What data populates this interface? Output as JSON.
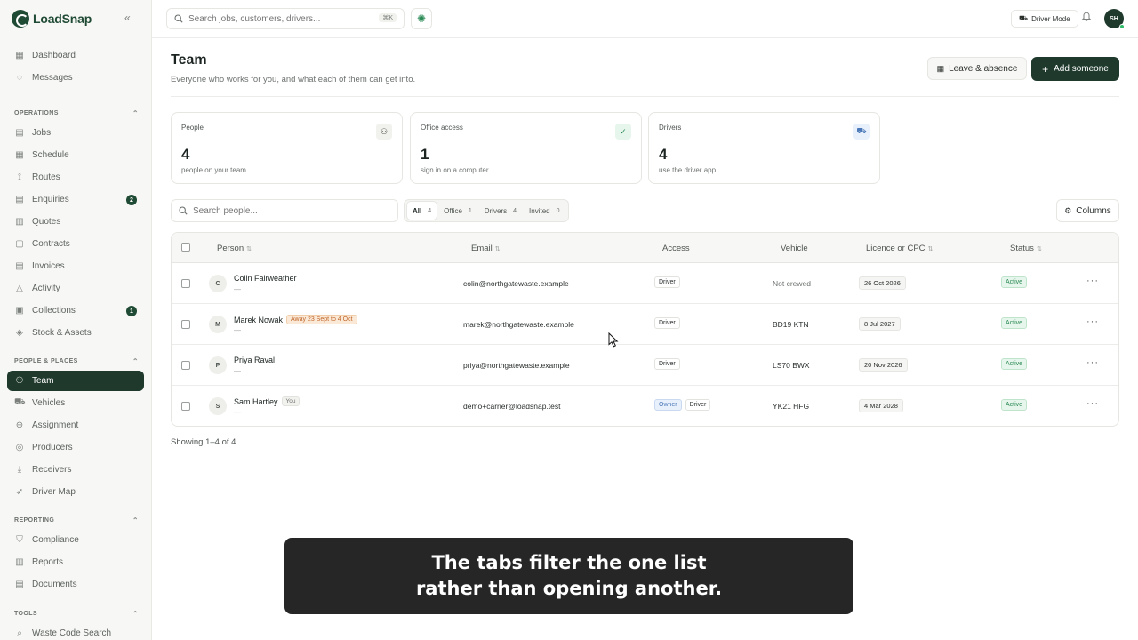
{
  "brand": {
    "name": "LoadSnap"
  },
  "sidebar": {
    "top_items": [
      {
        "label": "Dashboard",
        "icon": "grid-icon"
      },
      {
        "label": "Messages",
        "icon": "chat-icon"
      }
    ],
    "sections": [
      {
        "label": "OPERATIONS",
        "items": [
          {
            "label": "Jobs",
            "icon": "clipboard-icon"
          },
          {
            "label": "Schedule",
            "icon": "calendar-icon"
          },
          {
            "label": "Routes",
            "icon": "route-icon"
          },
          {
            "label": "Enquiries",
            "icon": "inbox-icon",
            "badge": "2"
          },
          {
            "label": "Quotes",
            "icon": "quote-icon"
          },
          {
            "label": "Contracts",
            "icon": "file-icon"
          },
          {
            "label": "Invoices",
            "icon": "invoice-icon"
          },
          {
            "label": "Activity",
            "icon": "activity-icon"
          },
          {
            "label": "Collections",
            "icon": "box-icon",
            "badge": "1"
          },
          {
            "label": "Stock & Assets",
            "icon": "cube-icon"
          }
        ]
      },
      {
        "label": "PEOPLE & PLACES",
        "items": [
          {
            "label": "Team",
            "icon": "users-icon",
            "active": true
          },
          {
            "label": "Vehicles",
            "icon": "truck-icon"
          },
          {
            "label": "Assignment",
            "icon": "link-icon"
          },
          {
            "label": "Producers",
            "icon": "pin-icon"
          },
          {
            "label": "Receivers",
            "icon": "download-icon"
          },
          {
            "label": "Driver Map",
            "icon": "navigation-icon"
          }
        ]
      },
      {
        "label": "REPORTING",
        "items": [
          {
            "label": "Compliance",
            "icon": "shield-icon"
          },
          {
            "label": "Reports",
            "icon": "bar-chart-icon"
          },
          {
            "label": "Documents",
            "icon": "document-icon"
          }
        ]
      },
      {
        "label": "TOOLS",
        "items": [
          {
            "label": "Waste Code Search",
            "icon": "search-icon"
          }
        ]
      }
    ]
  },
  "topbar": {
    "search_placeholder": "Search jobs, customers, drivers...",
    "search_shortcut": "⌘K",
    "driver_mode_label": "Driver Mode",
    "avatar_initials": "SH"
  },
  "header": {
    "title": "Team",
    "subtitle": "Everyone who works for you, and what each of them can get into.",
    "leave_label": "Leave & absence",
    "add_label": "Add someone"
  },
  "stats": [
    {
      "label": "People",
      "value": "4",
      "desc": "people on your team",
      "icon": "users-icon",
      "color": "#4e5450",
      "bg": "#f1f1ee"
    },
    {
      "label": "Office access",
      "value": "1",
      "desc": "sign in on a computer",
      "icon": "user-check-icon",
      "color": "#2a8a55",
      "bg": "#e7f6ec"
    },
    {
      "label": "Drivers",
      "value": "4",
      "desc": "use the driver app",
      "icon": "truck-icon",
      "color": "#4a78b8",
      "bg": "#e8f0fb"
    }
  ],
  "filters": {
    "search_placeholder": "Search people...",
    "tabs": [
      {
        "label": "All",
        "count": "4",
        "active": true
      },
      {
        "label": "Office",
        "count": "1"
      },
      {
        "label": "Drivers",
        "count": "4"
      },
      {
        "label": "Invited",
        "count": "0"
      }
    ],
    "columns_label": "Columns"
  },
  "table": {
    "headers": {
      "person": "Person",
      "email": "Email",
      "access": "Access",
      "vehicle": "Vehicle",
      "licence": "Licence or CPC",
      "status": "Status"
    },
    "rows": [
      {
        "initial": "C",
        "name": "Colin Fairweather",
        "sub": "—",
        "tag": "",
        "email": "colin@northgatewaste.example",
        "access": [
          "Driver"
        ],
        "vehicle": "Not crewed",
        "vehicle_muted": true,
        "licence": "26 Oct 2026",
        "status": "Active"
      },
      {
        "initial": "M",
        "name": "Marek Nowak",
        "sub": "—",
        "tag": "Away 23 Sept to 4 Oct",
        "tag_type": "away",
        "email": "marek@northgatewaste.example",
        "access": [
          "Driver"
        ],
        "vehicle": "BD19 KTN",
        "licence": "8 Jul 2027",
        "status": "Active"
      },
      {
        "initial": "P",
        "name": "Priya Raval",
        "sub": "—",
        "tag": "",
        "email": "priya@northgatewaste.example",
        "access": [
          "Driver"
        ],
        "vehicle": "LS70 BWX",
        "licence": "20 Nov 2026",
        "status": "Active"
      },
      {
        "initial": "S",
        "name": "Sam Hartley",
        "sub": "—",
        "tag": "You",
        "tag_type": "you",
        "email": "demo+carrier@loadsnap.test",
        "access": [
          "Owner",
          "Driver"
        ],
        "vehicle": "YK21 HFG",
        "licence": "4 Mar 2028",
        "status": "Active"
      }
    ]
  },
  "footer": {
    "showing": "Showing 1–4 of 4"
  },
  "caption": {
    "line1": "The tabs filter the one list",
    "line2": "rather than opening another."
  },
  "colors": {
    "brand": "#1f3a2d",
    "active_green": "#2a8a55",
    "owner_blue": "#4a78b8",
    "away_orange": "#c0672a"
  }
}
